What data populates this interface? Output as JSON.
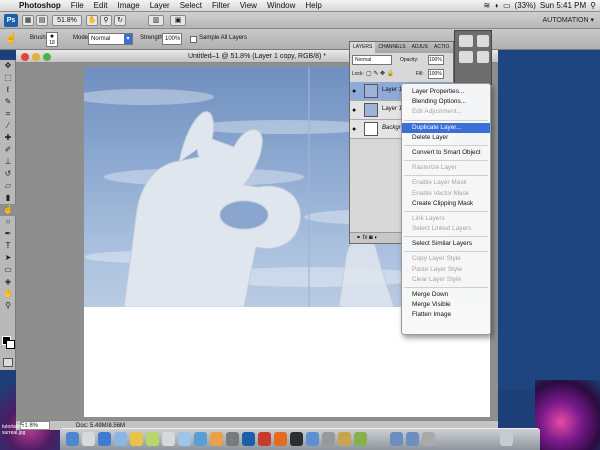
{
  "menubar": {
    "items": [
      "Photoshop",
      "File",
      "Edit",
      "Image",
      "Layer",
      "Select",
      "Filter",
      "View",
      "Window",
      "Help"
    ],
    "battery": "(33%)",
    "clock": "Sun 5:41 PM"
  },
  "appbar": {
    "ps_label": "Ps",
    "zoom": "51.8%",
    "workspace": "AUTOMATION ▾"
  },
  "options": {
    "brush_label": "Brush:",
    "brush_size": "18",
    "mode_label": "Mode:",
    "mode_value": "Normal",
    "strength_label": "Strength:",
    "strength_value": "100%",
    "sample_all": "Sample All Layers"
  },
  "document": {
    "title": "Untitled–1 @ 51.8% (Layer 1 copy, RGB/8) *",
    "zoom": "51.8%",
    "doc_size": "Doc: 5.49M/8.56M"
  },
  "layers_panel": {
    "tabs": [
      "LAYERS",
      "CHANNELS",
      "ADJUS",
      "ACTIO"
    ],
    "blend_mode": "Normal",
    "opacity_label": "Opacity:",
    "opacity_value": "100%",
    "lock_label": "Lock:",
    "fill_label": "Fill:",
    "fill_value": "100%",
    "layers": [
      "Layer 1 c",
      "Layer 1",
      "Backgrou"
    ]
  },
  "context_menu": {
    "items": [
      {
        "label": "Layer Properties...",
        "enabled": true
      },
      {
        "label": "Blending Options...",
        "enabled": true
      },
      {
        "label": "Edit Adjustment...",
        "enabled": false
      },
      {
        "sep": true
      },
      {
        "label": "Duplicate Layer...",
        "enabled": true,
        "highlighted": true
      },
      {
        "label": "Delete Layer",
        "enabled": true
      },
      {
        "sep": true
      },
      {
        "label": "Convert to Smart Object",
        "enabled": true
      },
      {
        "sep": true
      },
      {
        "label": "Rasterize Layer",
        "enabled": false
      },
      {
        "sep": true
      },
      {
        "label": "Enable Layer Mask",
        "enabled": false
      },
      {
        "label": "Enable Vector Mask",
        "enabled": false
      },
      {
        "label": "Create Clipping Mask",
        "enabled": true
      },
      {
        "sep": true
      },
      {
        "label": "Link Layers",
        "enabled": false
      },
      {
        "label": "Select Linked Layers",
        "enabled": false
      },
      {
        "sep": true
      },
      {
        "label": "Select Similar Layers",
        "enabled": true
      },
      {
        "sep": true
      },
      {
        "label": "Copy Layer Style",
        "enabled": false
      },
      {
        "label": "Paste Layer Style",
        "enabled": false
      },
      {
        "label": "Clear Layer Style",
        "enabled": false
      },
      {
        "sep": true
      },
      {
        "label": "Merge Down",
        "enabled": true
      },
      {
        "label": "Merge Visible",
        "enabled": true
      },
      {
        "label": "Flatten Image",
        "enabled": true
      }
    ]
  },
  "desktop": {
    "file_label": "tutorialimage\nsurreal.jpg"
  },
  "colors": {
    "highlight": "#3a6fd8",
    "desktop": "#1d3f78",
    "selected_layer": "#8fa9d8"
  }
}
